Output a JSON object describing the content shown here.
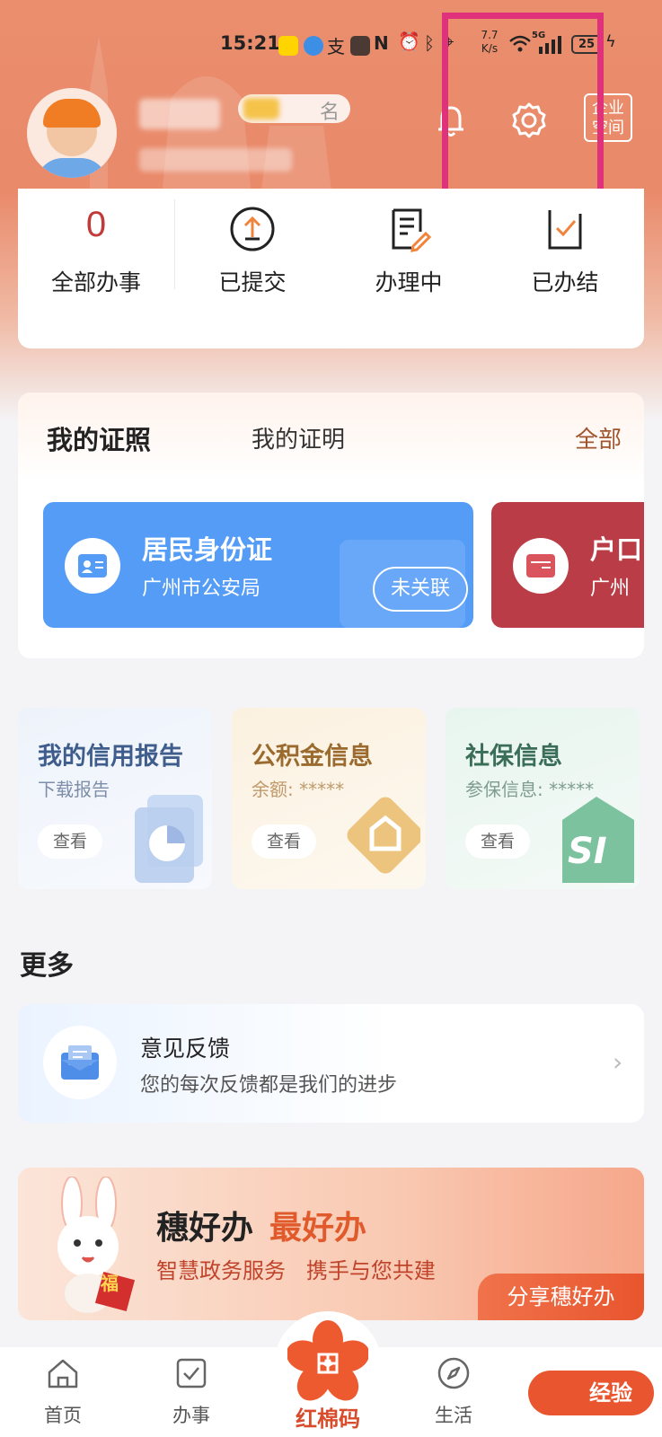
{
  "status_bar": {
    "time": "15:21",
    "net_speed_value": "7.7",
    "net_speed_unit": "K/s",
    "network": "5G",
    "battery": "25"
  },
  "header": {
    "name_badge_suffix": "名",
    "enterprise_label": "企业\n空间"
  },
  "task_stats": [
    {
      "label": "全部办事",
      "count": "0"
    },
    {
      "label": "已提交"
    },
    {
      "label": "办理中"
    },
    {
      "label": "已办结"
    }
  ],
  "certificates": {
    "tab_active": "我的证照",
    "tab_other": "我的证明",
    "all_link": "全部",
    "cards": [
      {
        "title": "居民身份证",
        "issuer": "广州市公安局",
        "action": "未关联",
        "color": "#559cf7"
      },
      {
        "title": "户口",
        "issuer": "广州",
        "color": "#b93c46"
      }
    ]
  },
  "services": [
    {
      "title": "我的信用报告",
      "subtitle": "下载报告",
      "button": "查看",
      "title_color": "#3f5d8c",
      "subtitle_color": "#7d8ea8"
    },
    {
      "title": "公积金信息",
      "subtitle": "余额: *****",
      "button": "查看",
      "title_color": "#9b6a2e",
      "subtitle_color": "#c09a6b"
    },
    {
      "title": "社保信息",
      "subtitle": "参保信息: *****",
      "button": "查看",
      "title_color": "#3b6e58",
      "subtitle_color": "#7f9d8f"
    }
  ],
  "more": {
    "section_title": "更多",
    "feedback_title": "意见反馈",
    "feedback_subtitle": "您的每次反馈都是我们的进步"
  },
  "banner": {
    "title_a": "穗好办",
    "title_b": "最好办",
    "subtitle": "智慧政务服务   携手与您共建",
    "share": "分享穗好办",
    "fu": "福"
  },
  "bottom_nav": {
    "home": "首页",
    "tasks": "办事",
    "center": "红棉码",
    "life": "生活",
    "experience": "经验"
  },
  "colors": {
    "accent": "#e8552e",
    "highlight_box": "#e0317b"
  }
}
